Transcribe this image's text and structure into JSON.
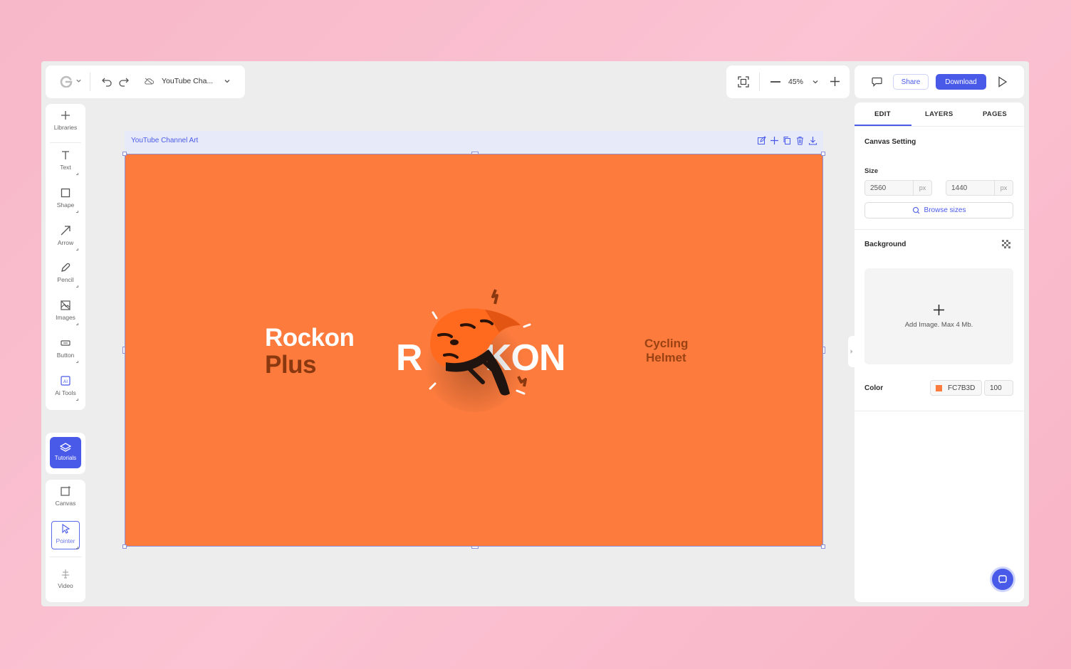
{
  "toolbar": {
    "document_title": "YouTube Cha...",
    "zoom": "45%",
    "share_label": "Share",
    "download_label": "Download"
  },
  "sidebar": {
    "tools": [
      {
        "label": "Libraries",
        "icon": "plus-icon"
      },
      {
        "label": "Text",
        "icon": "text-icon"
      },
      {
        "label": "Shape",
        "icon": "square-icon"
      },
      {
        "label": "Arrow",
        "icon": "arrow-icon"
      },
      {
        "label": "Pencil",
        "icon": "pencil-icon"
      },
      {
        "label": "Images",
        "icon": "image-icon"
      },
      {
        "label": "Button",
        "icon": "button-icon"
      },
      {
        "label": "Ai Tools",
        "icon": "ai-icon"
      }
    ],
    "tutorials_label": "Tutorials",
    "canvas_label": "Canvas",
    "pointer_label": "Pointer",
    "video_label": "Video"
  },
  "artboard": {
    "name": "YouTube Channel Art",
    "title_line1": "Rockon",
    "title_line2": "Plus",
    "center_text": "ROCKON",
    "center_text_visible_left": "R",
    "center_text_visible_right": "KON",
    "side_line1": "Cycling",
    "side_line2": "Helmet",
    "background_color": "#FC7B3D"
  },
  "settings": {
    "tabs": [
      "EDIT",
      "LAYERS",
      "PAGES"
    ],
    "active_tab": "EDIT",
    "canvas_setting_title": "Canvas Setting",
    "size_label": "Size",
    "width": "2560",
    "height": "1440",
    "unit": "px",
    "browse_sizes_label": "Browse sizes",
    "background_label": "Background",
    "add_image_label": "Add Image. Max 4 Mb.",
    "color_label": "Color",
    "color_hex": "FC7B3D",
    "opacity": "100"
  },
  "colors": {
    "accent": "#4a5ae8",
    "canvas_orange": "#fc7b3d"
  }
}
